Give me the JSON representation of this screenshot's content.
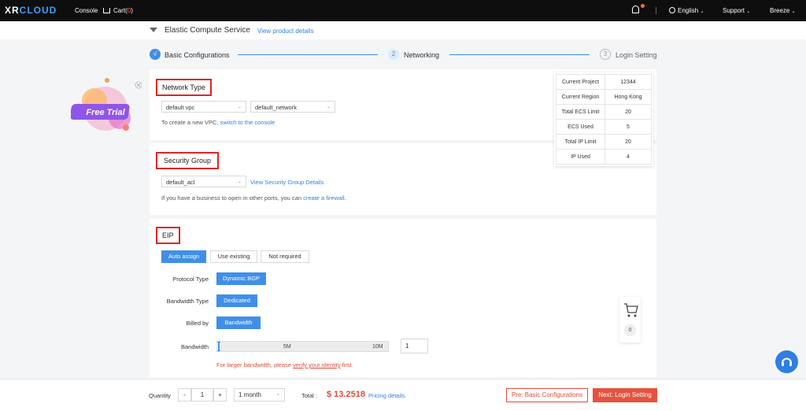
{
  "topbar": {
    "logo_a": "XR",
    "logo_b": "CLOUD",
    "console": "Console",
    "cart": "Cart(",
    "cart_count": "0",
    "cart_close": ")",
    "language": "English",
    "support": "Support",
    "user": "Breeze"
  },
  "crumb": {
    "title": "Elastic Compute Service",
    "link": "View product details"
  },
  "steps": [
    {
      "num": "√",
      "label": "Basic Configurations"
    },
    {
      "num": "2",
      "label": "Networking"
    },
    {
      "num": "3",
      "label": "Login Setting"
    }
  ],
  "network": {
    "title": "Network Type",
    "vpc": "default vpc",
    "network": "default_network",
    "hint": "To create a new VPC, ",
    "hint_link": "switch to the console"
  },
  "security": {
    "title": "Security Group",
    "group": "default_acl",
    "details_link": "View Security Group Details",
    "hint": "If you have a business to open in other ports, you can ",
    "hint_link": "create a firewall",
    "hint_end": "."
  },
  "eip": {
    "title": "EIP",
    "options": [
      "Auto assign",
      "Use existing",
      "Not required"
    ],
    "protocol_label": "Protocol Type",
    "protocol_value": "Dynamic BGP",
    "bw_type_label": "Bandwidth Type",
    "bw_type_value": "Dedicated",
    "billed_label": "Billed by",
    "billed_value": "Bandwidth",
    "bandwidth_label": "Bandwidth",
    "slider_marks": [
      "5M",
      "10M"
    ],
    "bandwidth_value": "1",
    "bandwidth_fraction": 0.02,
    "warn": "For larger bandwidth, please ",
    "warn_link": "verify your identity",
    "warn_end": " first."
  },
  "quota": {
    "rows": [
      {
        "k": "Current Project",
        "v": "12344"
      },
      {
        "k": "Current Region",
        "v": "Hong Kong"
      },
      {
        "k": "Total ECS Limit",
        "v": "20"
      },
      {
        "k": "ECS Used",
        "v": "5"
      },
      {
        "k": "Total IP Limit",
        "v": "20"
      },
      {
        "k": "IP Used",
        "v": "4"
      }
    ]
  },
  "promo": {
    "label": "Free Trial"
  },
  "cart_float": {
    "count": "0"
  },
  "footer": {
    "quantity_label": "Quantity",
    "minus": "-",
    "qty": "1",
    "plus": "+",
    "duration": "1 month",
    "total_label": "Total :",
    "total_value": "$ 13.2518",
    "pricing_link": "Pricing details",
    "prev": "Pre: Basic Configurations",
    "next": "Next: Login Setting"
  },
  "colors": {
    "accent": "#3f8fe8",
    "danger": "#e24b3b",
    "topbar": "#0e0e0e"
  }
}
